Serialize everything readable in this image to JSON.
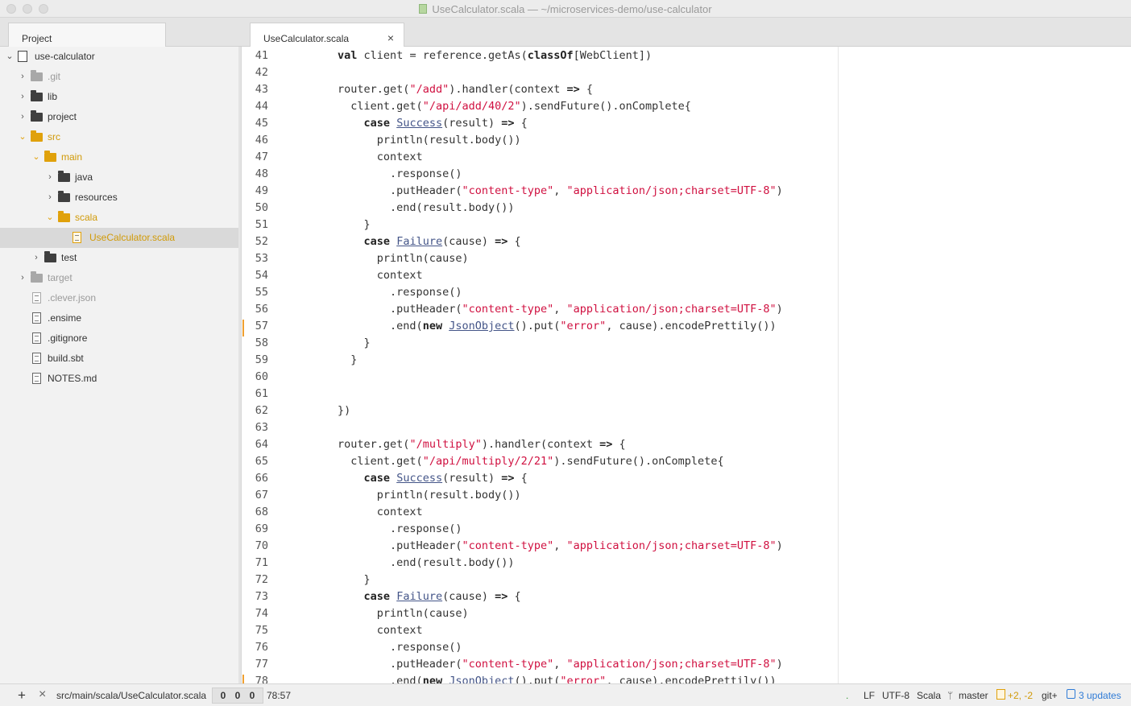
{
  "window": {
    "title": "UseCalculator.scala — ~/microservices-demo/use-calculator"
  },
  "tabs": {
    "project_label": "Project",
    "editor_tab_label": "UseCalculator.scala",
    "close_glyph": "×"
  },
  "tree": {
    "items": [
      {
        "label": "use-calculator",
        "kind": "repo",
        "chev": "⌄",
        "depth": 0,
        "style": "normal"
      },
      {
        "label": ".git",
        "kind": "folder",
        "chev": "›",
        "depth": 1,
        "style": "muted"
      },
      {
        "label": "lib",
        "kind": "folder",
        "chev": "›",
        "depth": 1,
        "style": "normal"
      },
      {
        "label": "project",
        "kind": "folder",
        "chev": "›",
        "depth": 1,
        "style": "normal"
      },
      {
        "label": "src",
        "kind": "folder",
        "chev": "⌄",
        "depth": 1,
        "style": "orange"
      },
      {
        "label": "main",
        "kind": "folder",
        "chev": "⌄",
        "depth": 2,
        "style": "orange"
      },
      {
        "label": "java",
        "kind": "folder",
        "chev": "›",
        "depth": 3,
        "style": "normal"
      },
      {
        "label": "resources",
        "kind": "folder",
        "chev": "›",
        "depth": 3,
        "style": "normal"
      },
      {
        "label": "scala",
        "kind": "folder",
        "chev": "⌄",
        "depth": 3,
        "style": "orange"
      },
      {
        "label": "UseCalculator.scala",
        "kind": "file",
        "chev": "",
        "depth": 4,
        "style": "orange",
        "selected": true
      },
      {
        "label": "test",
        "kind": "folder",
        "chev": "›",
        "depth": 2,
        "style": "normal"
      },
      {
        "label": "target",
        "kind": "folder",
        "chev": "›",
        "depth": 1,
        "style": "muted"
      },
      {
        "label": ".clever.json",
        "kind": "file",
        "chev": "",
        "depth": 1,
        "style": "muted"
      },
      {
        "label": ".ensime",
        "kind": "file",
        "chev": "",
        "depth": 1,
        "style": "normal"
      },
      {
        "label": ".gitignore",
        "kind": "file",
        "chev": "",
        "depth": 1,
        "style": "normal"
      },
      {
        "label": "build.sbt",
        "kind": "file",
        "chev": "",
        "depth": 1,
        "style": "normal"
      },
      {
        "label": "NOTES.md",
        "kind": "file",
        "chev": "",
        "depth": 1,
        "style": "normal"
      }
    ]
  },
  "editor": {
    "lines": [
      {
        "n": "41",
        "tokens": [
          [
            "p",
            "        "
          ],
          [
            "k",
            "val"
          ],
          [
            "p",
            " client = reference.getAs("
          ],
          [
            "k",
            "classOf"
          ],
          [
            "p",
            "[WebClient])"
          ]
        ]
      },
      {
        "n": "42",
        "tokens": []
      },
      {
        "n": "43",
        "tokens": [
          [
            "p",
            "        router.get("
          ],
          [
            "s",
            "\"/add\""
          ],
          [
            "p",
            ").handler(context "
          ],
          [
            "k",
            "=>"
          ],
          [
            "p",
            " {"
          ]
        ]
      },
      {
        "n": "44",
        "tokens": [
          [
            "p",
            "          client.get("
          ],
          [
            "s",
            "\"/api/add/40/2\""
          ],
          [
            "p",
            ").sendFuture().onComplete{"
          ]
        ]
      },
      {
        "n": "45",
        "tokens": [
          [
            "p",
            "            "
          ],
          [
            "k",
            "case"
          ],
          [
            "p",
            " "
          ],
          [
            "t",
            "Success"
          ],
          [
            "p",
            "(result) "
          ],
          [
            "k",
            "=>"
          ],
          [
            "p",
            " {"
          ]
        ]
      },
      {
        "n": "46",
        "tokens": [
          [
            "p",
            "              println(result.body())"
          ]
        ]
      },
      {
        "n": "47",
        "tokens": [
          [
            "p",
            "              context"
          ]
        ]
      },
      {
        "n": "48",
        "tokens": [
          [
            "p",
            "                .response()"
          ]
        ]
      },
      {
        "n": "49",
        "tokens": [
          [
            "p",
            "                .putHeader("
          ],
          [
            "s",
            "\"content-type\""
          ],
          [
            "p",
            ", "
          ],
          [
            "s",
            "\"application/json;charset=UTF-8\""
          ],
          [
            "p",
            ")"
          ]
        ]
      },
      {
        "n": "50",
        "tokens": [
          [
            "p",
            "                .end(result.body())"
          ]
        ]
      },
      {
        "n": "51",
        "tokens": [
          [
            "p",
            "            }"
          ]
        ]
      },
      {
        "n": "52",
        "tokens": [
          [
            "p",
            "            "
          ],
          [
            "k",
            "case"
          ],
          [
            "p",
            " "
          ],
          [
            "t",
            "Failure"
          ],
          [
            "p",
            "(cause) "
          ],
          [
            "k",
            "=>"
          ],
          [
            "p",
            " {"
          ]
        ]
      },
      {
        "n": "53",
        "tokens": [
          [
            "p",
            "              println(cause)"
          ]
        ]
      },
      {
        "n": "54",
        "tokens": [
          [
            "p",
            "              context"
          ]
        ]
      },
      {
        "n": "55",
        "tokens": [
          [
            "p",
            "                .response()"
          ]
        ]
      },
      {
        "n": "56",
        "tokens": [
          [
            "p",
            "                .putHeader("
          ],
          [
            "s",
            "\"content-type\""
          ],
          [
            "p",
            ", "
          ],
          [
            "s",
            "\"application/json;charset=UTF-8\""
          ],
          [
            "p",
            ")"
          ]
        ]
      },
      {
        "n": "57",
        "tokens": [
          [
            "p",
            "                .end("
          ],
          [
            "k",
            "new"
          ],
          [
            "p",
            " "
          ],
          [
            "t",
            "JsonObject"
          ],
          [
            "p",
            "().put("
          ],
          [
            "s",
            "\"error\""
          ],
          [
            "p",
            ", cause).encodePrettily())"
          ]
        ]
      },
      {
        "n": "58",
        "tokens": [
          [
            "p",
            "            }"
          ]
        ]
      },
      {
        "n": "59",
        "tokens": [
          [
            "p",
            "          }"
          ]
        ]
      },
      {
        "n": "60",
        "tokens": []
      },
      {
        "n": "61",
        "tokens": []
      },
      {
        "n": "62",
        "tokens": [
          [
            "p",
            "        })"
          ]
        ]
      },
      {
        "n": "63",
        "tokens": []
      },
      {
        "n": "64",
        "tokens": [
          [
            "p",
            "        router.get("
          ],
          [
            "s",
            "\"/multiply\""
          ],
          [
            "p",
            ").handler(context "
          ],
          [
            "k",
            "=>"
          ],
          [
            "p",
            " {"
          ]
        ]
      },
      {
        "n": "65",
        "tokens": [
          [
            "p",
            "          client.get("
          ],
          [
            "s",
            "\"/api/multiply/2/21\""
          ],
          [
            "p",
            ").sendFuture().onComplete{"
          ]
        ]
      },
      {
        "n": "66",
        "tokens": [
          [
            "p",
            "            "
          ],
          [
            "k",
            "case"
          ],
          [
            "p",
            " "
          ],
          [
            "t",
            "Success"
          ],
          [
            "p",
            "(result) "
          ],
          [
            "k",
            "=>"
          ],
          [
            "p",
            " {"
          ]
        ]
      },
      {
        "n": "67",
        "tokens": [
          [
            "p",
            "              println(result.body())"
          ]
        ]
      },
      {
        "n": "68",
        "tokens": [
          [
            "p",
            "              context"
          ]
        ]
      },
      {
        "n": "69",
        "tokens": [
          [
            "p",
            "                .response()"
          ]
        ]
      },
      {
        "n": "70",
        "tokens": [
          [
            "p",
            "                .putHeader("
          ],
          [
            "s",
            "\"content-type\""
          ],
          [
            "p",
            ", "
          ],
          [
            "s",
            "\"application/json;charset=UTF-8\""
          ],
          [
            "p",
            ")"
          ]
        ]
      },
      {
        "n": "71",
        "tokens": [
          [
            "p",
            "                .end(result.body())"
          ]
        ]
      },
      {
        "n": "72",
        "tokens": [
          [
            "p",
            "            }"
          ]
        ]
      },
      {
        "n": "73",
        "tokens": [
          [
            "p",
            "            "
          ],
          [
            "k",
            "case"
          ],
          [
            "p",
            " "
          ],
          [
            "t",
            "Failure"
          ],
          [
            "p",
            "(cause) "
          ],
          [
            "k",
            "=>"
          ],
          [
            "p",
            " {"
          ]
        ]
      },
      {
        "n": "74",
        "tokens": [
          [
            "p",
            "              println(cause)"
          ]
        ]
      },
      {
        "n": "75",
        "tokens": [
          [
            "p",
            "              context"
          ]
        ]
      },
      {
        "n": "76",
        "tokens": [
          [
            "p",
            "                .response()"
          ]
        ]
      },
      {
        "n": "77",
        "tokens": [
          [
            "p",
            "                .putHeader("
          ],
          [
            "s",
            "\"content-type\""
          ],
          [
            "p",
            ", "
          ],
          [
            "s",
            "\"application/json;charset=UTF-8\""
          ],
          [
            "p",
            ")"
          ]
        ]
      },
      {
        "n": "78",
        "tokens": [
          [
            "p",
            "                .end("
          ],
          [
            "k",
            "new"
          ],
          [
            "p",
            " "
          ],
          [
            "t",
            "JsonObject"
          ],
          [
            "p",
            "().put("
          ],
          [
            "s",
            "\"error\""
          ],
          [
            "p",
            ", cause).encodePrettily())"
          ]
        ]
      }
    ],
    "modified_lines": [
      "57",
      "78"
    ]
  },
  "status": {
    "add_glyph": "+",
    "close_glyph": "×",
    "file_path": "src/main/scala/UseCalculator.scala",
    "counts": [
      "0",
      "0",
      "0"
    ],
    "cursor": "78:57",
    "dot": ".",
    "line_ending": "LF",
    "encoding": "UTF-8",
    "grammar": "Scala",
    "branch_icon": "ᛘ",
    "branch": "master",
    "diff": "+2, -2",
    "git_plus": "git+",
    "updates": "3 updates"
  },
  "colors": {
    "keyword": "#222222",
    "string": "#d01040",
    "type": "#445588",
    "accent_orange": "#e0a10b",
    "updates_blue": "#2f7bd6"
  }
}
